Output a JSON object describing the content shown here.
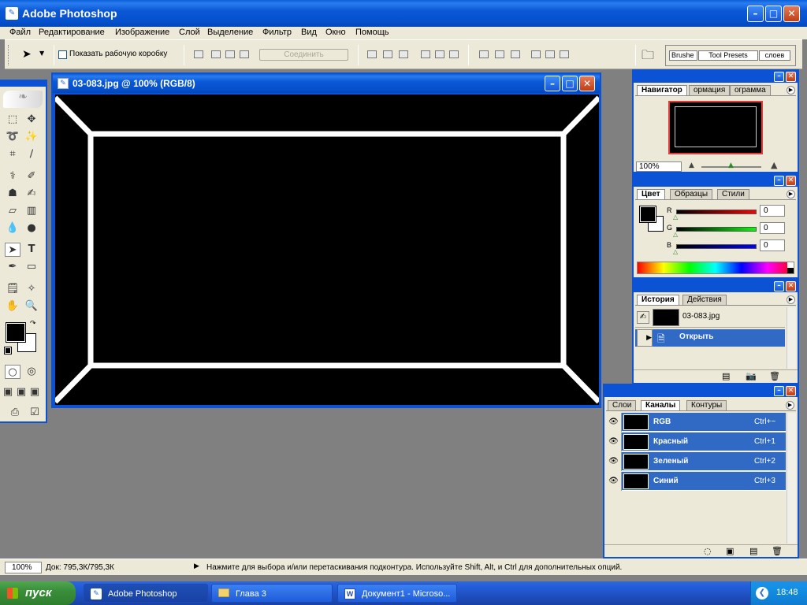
{
  "app": {
    "title": "Adobe Photoshop"
  },
  "menu": [
    "Файл",
    "Редактирование",
    "Изображение",
    "Слой",
    "Выделение",
    "Фильтр",
    "Вид",
    "Окно",
    "Помощь"
  ],
  "options": {
    "show_box_label": "Показать рабочую коробку",
    "combine_label": "Соединить",
    "wells": [
      "Brushe",
      "Tool Presets",
      "слоев"
    ]
  },
  "document": {
    "title": "03-083.jpg @ 100% (RGB/8)"
  },
  "navigator": {
    "tabs": [
      "Навигатор",
      "ормация",
      "ограмма"
    ],
    "zoom": "100%"
  },
  "color": {
    "tabs": [
      "Цвет",
      "Образцы",
      "Стили"
    ],
    "r_label": "R",
    "g_label": "G",
    "b_label": "B",
    "r": "0",
    "g": "0",
    "b": "0"
  },
  "history": {
    "tabs": [
      "История",
      "Действия"
    ],
    "snapshot": "03-083.jpg",
    "step": "Открыть"
  },
  "layers": {
    "tabs": [
      "Слои",
      "Каналы",
      "Контуры"
    ],
    "channels": [
      {
        "name": "RGB",
        "shortcut": "Ctrl+~"
      },
      {
        "name": "Красный",
        "shortcut": "Ctrl+1"
      },
      {
        "name": "Зеленый",
        "shortcut": "Ctrl+2"
      },
      {
        "name": "Синий",
        "shortcut": "Ctrl+3"
      }
    ]
  },
  "status": {
    "zoom": "100%",
    "doc": "Док: 795,3К/795,3К",
    "hint": "Нажмите для выбора и/или перетаскивания подконтура.  Используйте Shift, Alt, и Ctrl для дополнительных опций."
  },
  "taskbar": {
    "start": "пуск",
    "tasks": [
      "Adobe Photoshop",
      "Глава 3",
      "Документ1 - Microso..."
    ],
    "clock": "18:48"
  },
  "colors": {
    "title_blue": "#0c52d4",
    "selected_row": "#316ac5",
    "canvas": "#000000",
    "frame": "#ffffff"
  }
}
